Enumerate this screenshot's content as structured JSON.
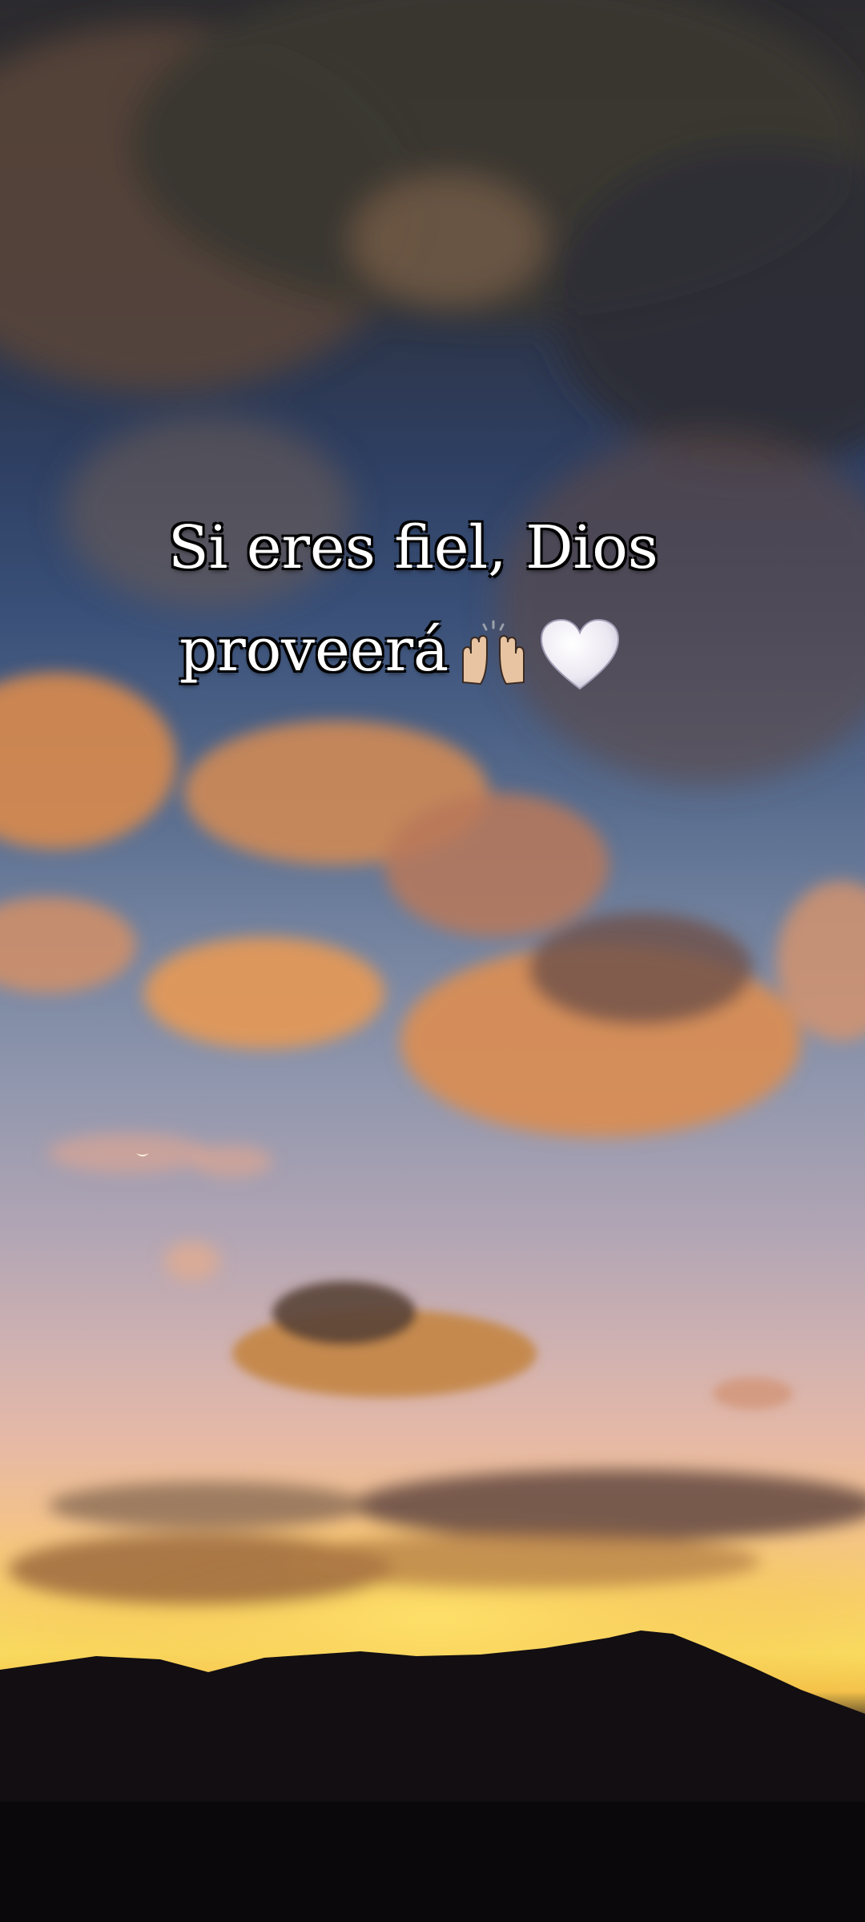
{
  "caption": {
    "line1": "Si eres fiel,  Dios",
    "line2": "proveerá"
  },
  "emojis": [
    "raising-hands-icon",
    "white-heart-icon"
  ],
  "colors": {
    "sky_top": "#2b2a2e",
    "sky_mid": "#52678a",
    "sunset_glow": "#f9dc60",
    "cloud_orange": "#e0944f",
    "mountain": "#0e0b10",
    "text": "#ffffff",
    "text_outline": "#000000"
  }
}
